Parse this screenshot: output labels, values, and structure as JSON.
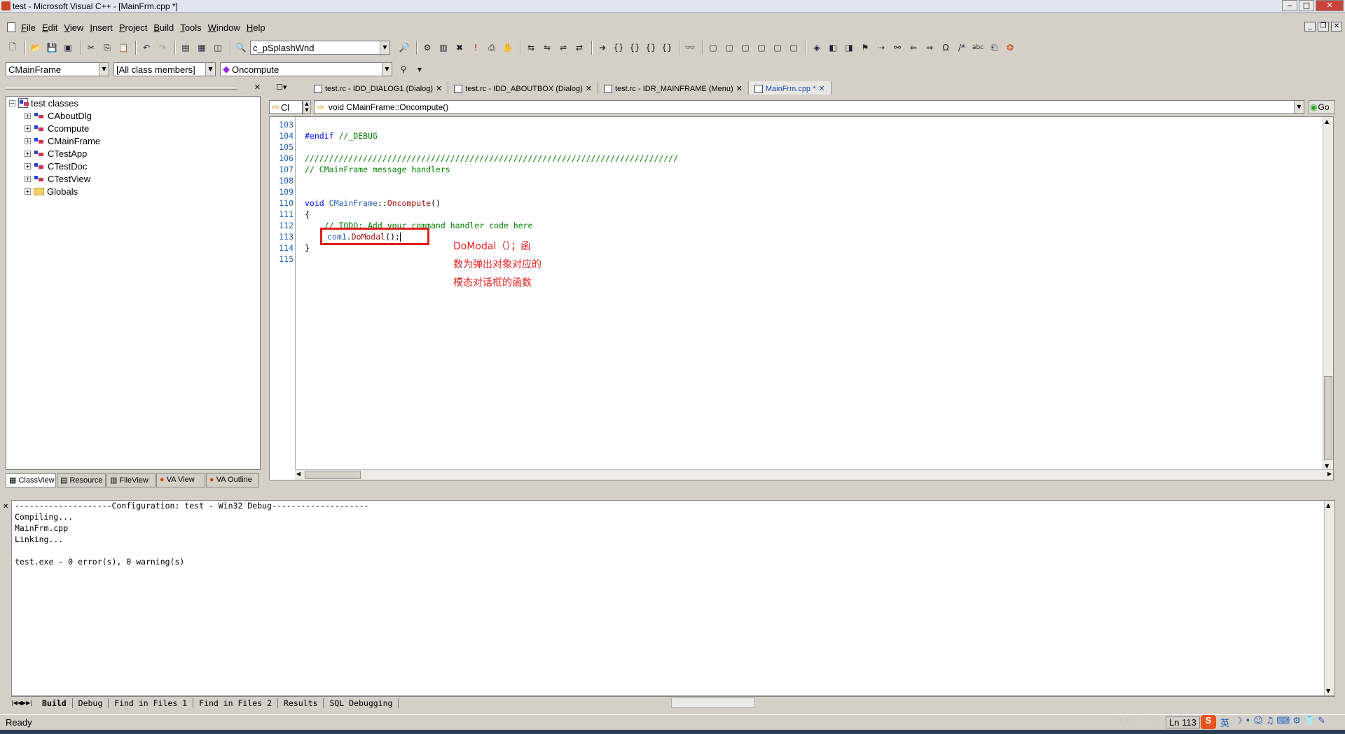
{
  "window": {
    "title": "test - Microsoft Visual C++ - [MainFrm.cpp *]"
  },
  "menu": [
    "File",
    "Edit",
    "View",
    "Insert",
    "Project",
    "Build",
    "Tools",
    "Window",
    "Help"
  ],
  "toolbar": {
    "splash_combo": "c_pSplashWnd"
  },
  "wizardbar": {
    "class_combo": "CMainFrame",
    "filter_combo": "[All class members]",
    "member_combo": "Oncompute"
  },
  "classview": {
    "root": "test classes",
    "items": [
      "CAboutDlg",
      "Ccompute",
      "CMainFrame",
      "CTestApp",
      "CTestDoc",
      "CTestView",
      "Globals"
    ],
    "tabs": [
      "ClassView",
      "Resource",
      "FileView",
      "VA View",
      "VA Outline"
    ]
  },
  "doc_tabs": [
    "test.rc - IDD_DIALOG1 (Dialog)",
    "test.rc - IDD_ABOUTBOX (Dialog)",
    "test.rc - IDR_MAINFRAME (Menu)",
    "MainFrm.cpp *"
  ],
  "va_bar": {
    "context_combo": "Cl",
    "method_combo": "void CMainFrame::Oncompute()",
    "go_button": "Go"
  },
  "code": {
    "line_numbers": [
      "103",
      "104",
      "105",
      "106",
      "107",
      "108",
      "109",
      "110",
      "111",
      "112",
      "113",
      "114",
      "115"
    ],
    "l104_directive": "#endif",
    "l104_comment": " //_DEBUG",
    "l106": "/////////////////////////////////////////////////////////////////////////////",
    "l107": "// CMainFrame message handlers",
    "l110_void": "void",
    "l110_class": "CMainFrame",
    "l110_sep": "::",
    "l110_fn": "Oncompute",
    "l110_paren": "()",
    "l111": "{",
    "l112": "    // TODO: Add your command handler code here",
    "l113_obj": "com1",
    "l113_dot": ".",
    "l113_fn": "DoModal",
    "l113_rest": "();",
    "l114": "}"
  },
  "annotation": {
    "lines": [
      "DoModal（）；函",
      "数为弹出对象对应的",
      "模态对话框的函数"
    ],
    "color": "#e01e1e"
  },
  "output": {
    "lines": [
      "--------------------Configuration: test - Win32 Debug--------------------",
      "Compiling...",
      "MainFrm.cpp",
      "Linking...",
      "",
      "test.exe - 0 error(s), 0 warning(s)"
    ],
    "tabs": [
      "Build",
      "Debug",
      "Find in Files 1",
      "Find in Files 2",
      "Results",
      "SQL Debugging"
    ]
  },
  "status": {
    "text": "Ready",
    "position": "Ln 113",
    "watermark": "http://b",
    "ime": "英"
  },
  "colors": {
    "keyword": "#0000ff",
    "comment": "#008000",
    "line_number": "#1c5fae",
    "highlight_box": "#e01e1e"
  }
}
